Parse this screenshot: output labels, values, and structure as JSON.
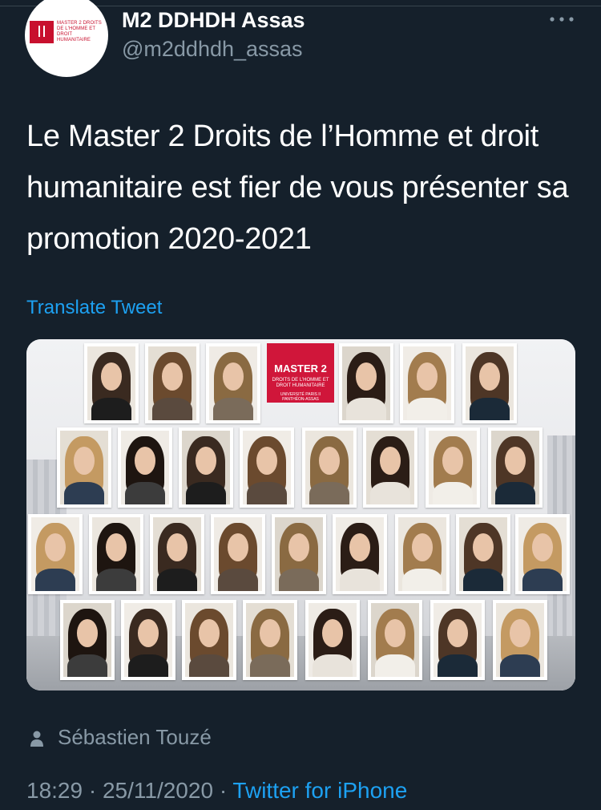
{
  "tweet": {
    "display_name": "M2 DDHDH Assas",
    "handle": "@m2ddhdh_assas",
    "avatar_text": "MASTER 2 DROITS DE L'HOMME ET DROIT HUMANITAIRE",
    "text": "Le Master 2 Droits de l’Homme et droit humanitaire est fier de vous présenter sa promotion 2020-2021",
    "translate_label": "Translate Tweet",
    "author_credit": "Sébastien Touzé",
    "time": "18:29",
    "date": "25/11/2020",
    "separator": "·",
    "source": "Twitter for iPhone"
  },
  "media": {
    "card_title": "MASTER 2",
    "card_subtitle": "DROITS DE L’HOMME ET DROIT HUMANITAIRE",
    "card_university": "UNIVERSITÉ PARIS II PANTHÉON-ASSAS"
  },
  "icons": {
    "more": "more-horizontal-icon",
    "person": "person-icon"
  },
  "colors": {
    "background": "#15202b",
    "text_primary": "#ffffff",
    "text_secondary": "#8899a6",
    "link": "#1da1f2",
    "brand_red": "#d0163a"
  }
}
